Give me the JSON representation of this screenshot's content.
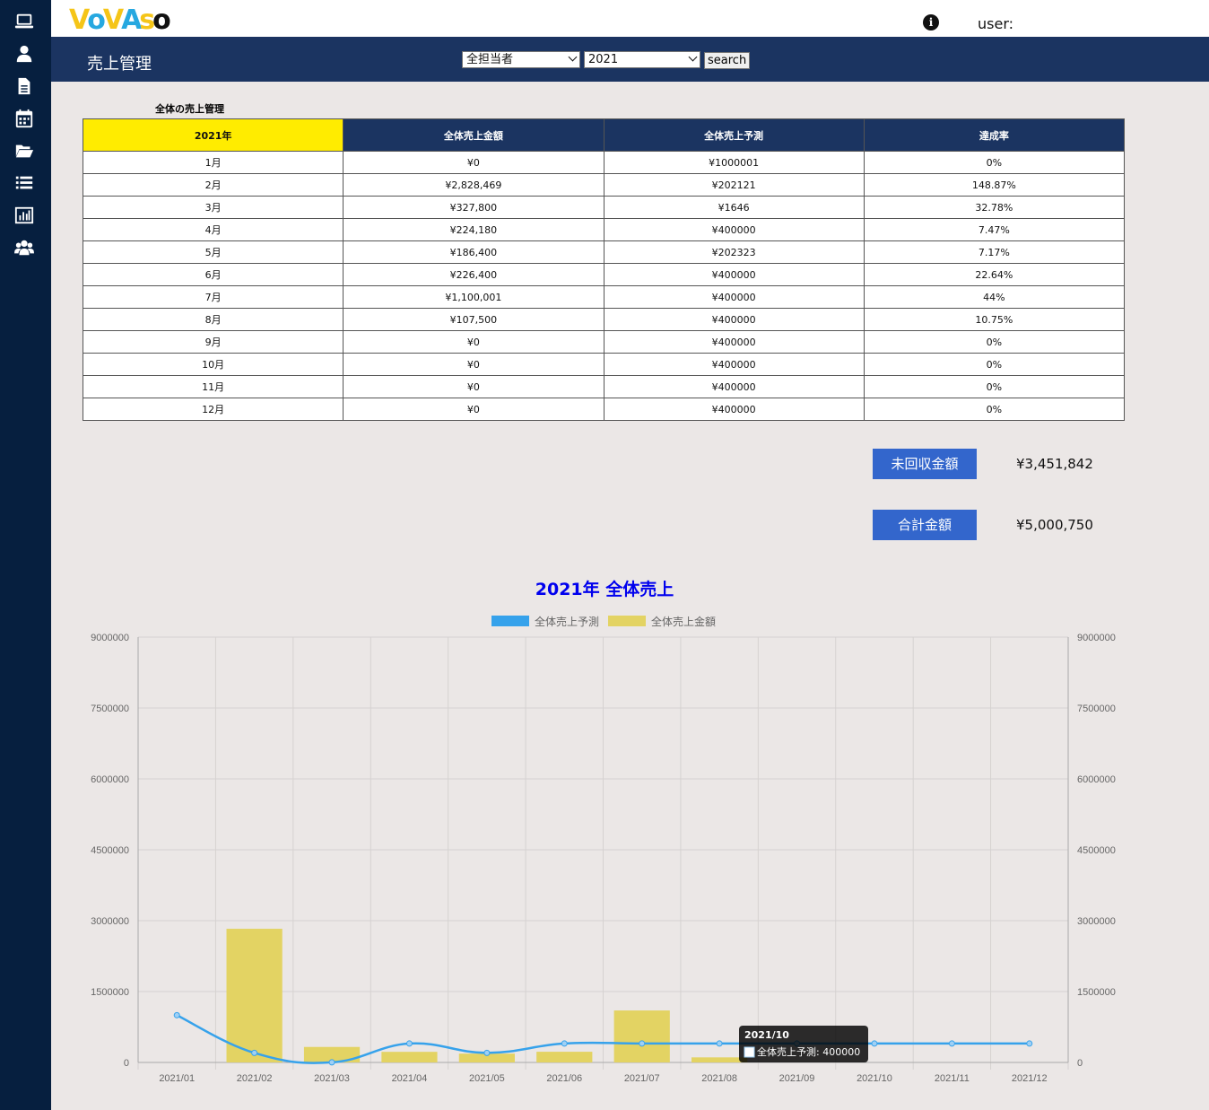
{
  "sidebar": {
    "items": [
      {
        "icon": "laptop-icon"
      },
      {
        "icon": "user-icon"
      },
      {
        "icon": "document-icon"
      },
      {
        "icon": "calendar-icon"
      },
      {
        "icon": "folder-open-icon"
      },
      {
        "icon": "list-icon"
      },
      {
        "icon": "bar-chart-icon"
      },
      {
        "icon": "users-icon"
      }
    ]
  },
  "topbar": {
    "logo": "VOVASO",
    "user_label": "user:"
  },
  "header": {
    "title": "売上管理",
    "person_select": "全担当者",
    "year_select": "2021",
    "search_label": "search"
  },
  "table": {
    "caption": "全体の売上管理",
    "headers": [
      "2021年",
      "全体売上金額",
      "全体売上予測",
      "達成率"
    ],
    "rows": [
      [
        "1月",
        "¥0",
        "¥1000001",
        "0%"
      ],
      [
        "2月",
        "¥2,828,469",
        "¥202121",
        "148.87%"
      ],
      [
        "3月",
        "¥327,800",
        "¥1646",
        "32.78%"
      ],
      [
        "4月",
        "¥224,180",
        "¥400000",
        "7.47%"
      ],
      [
        "5月",
        "¥186,400",
        "¥202323",
        "7.17%"
      ],
      [
        "6月",
        "¥226,400",
        "¥400000",
        "22.64%"
      ],
      [
        "7月",
        "¥1,100,001",
        "¥400000",
        "44%"
      ],
      [
        "8月",
        "¥107,500",
        "¥400000",
        "10.75%"
      ],
      [
        "9月",
        "¥0",
        "¥400000",
        "0%"
      ],
      [
        "10月",
        "¥0",
        "¥400000",
        "0%"
      ],
      [
        "11月",
        "¥0",
        "¥400000",
        "0%"
      ],
      [
        "12月",
        "¥0",
        "¥400000",
        "0%"
      ]
    ]
  },
  "summary": {
    "uncollected_label": "未回収金額",
    "uncollected_value": "¥3,451,842",
    "total_label": "合計金額",
    "total_value": "¥5,000,750"
  },
  "colors": {
    "sidebar": "#061f3f",
    "header": "#1b3461",
    "highlight": "#ffec00",
    "button": "#3366cc",
    "line": "#36a2eb",
    "bar": "#e3d363"
  },
  "chart_data": {
    "type": "bar",
    "title": "2021年 全体売上",
    "categories": [
      "2021/01",
      "2021/02",
      "2021/03",
      "2021/04",
      "2021/05",
      "2021/06",
      "2021/07",
      "2021/08",
      "2021/09",
      "2021/10",
      "2021/11",
      "2021/12"
    ],
    "series": [
      {
        "name": "全体売上予測",
        "type": "line",
        "color": "#36a2eb",
        "values": [
          1000001,
          202121,
          1646,
          400000,
          202323,
          400000,
          400000,
          400000,
          400000,
          400000,
          400000,
          400000
        ]
      },
      {
        "name": "全体売上金額",
        "type": "bar",
        "color": "#e3d363",
        "values": [
          0,
          2828469,
          327800,
          224180,
          186400,
          226400,
          1100001,
          107500,
          0,
          0,
          0,
          0
        ]
      }
    ],
    "yticks": [
      0,
      1500000,
      3000000,
      4500000,
      6000000,
      7500000,
      9000000
    ],
    "ylim": [
      0,
      9000000
    ],
    "grid": true,
    "legend": "top-center",
    "tooltip": {
      "title": "2021/10",
      "text": "全体売上予測: 400000"
    }
  }
}
